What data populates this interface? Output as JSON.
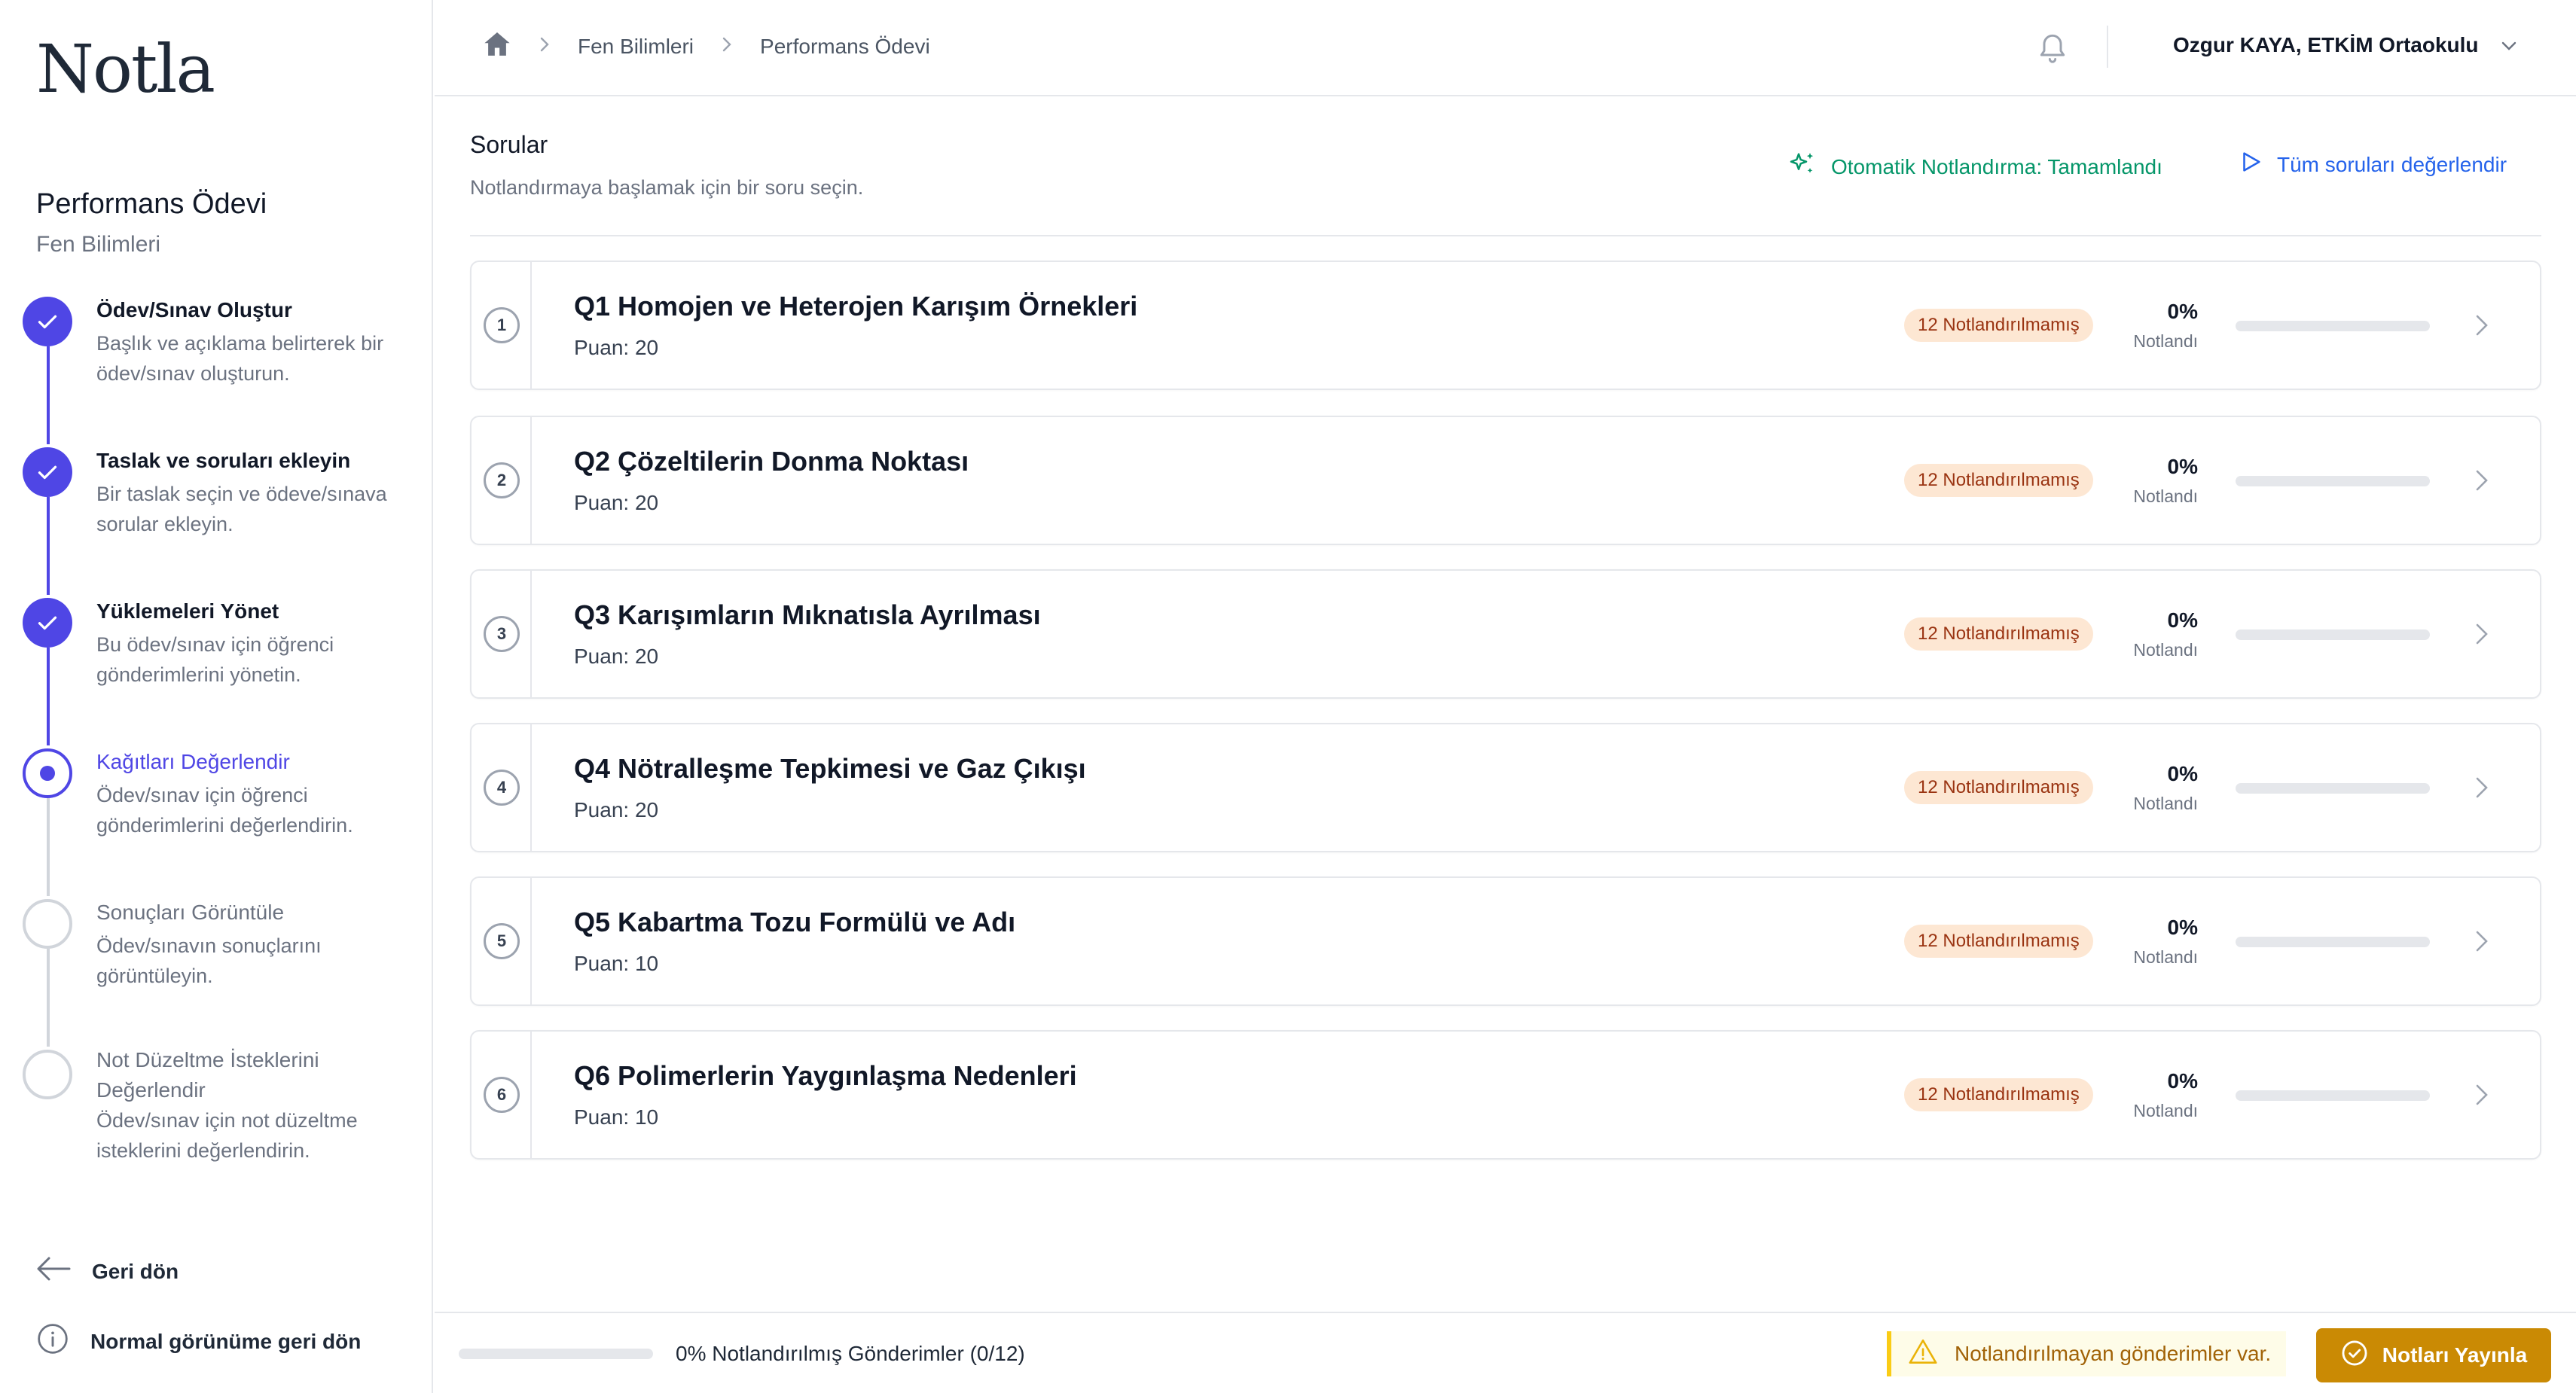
{
  "app": {
    "logo": "Notla"
  },
  "assignment": {
    "title": "Performans Ödevi",
    "subject": "Fen Bilimleri"
  },
  "steps": [
    {
      "title": "Ödev/Sınav Oluştur",
      "desc": "Başlık ve açıklama belirterek bir ödev/sınav oluşturun.",
      "state": "done"
    },
    {
      "title": "Taslak ve soruları ekleyin",
      "desc": "Bir taslak seçin ve ödeve/sınava sorular ekleyin.",
      "state": "done"
    },
    {
      "title": "Yüklemeleri Yönet",
      "desc": "Bu ödev/sınav için öğrenci gönderimlerini yönetin.",
      "state": "done"
    },
    {
      "title": "Kağıtları Değerlendir",
      "desc": "Ödev/sınav için öğrenci gönderimlerini değerlendirin.",
      "state": "current"
    },
    {
      "title": "Sonuçları Görüntüle",
      "desc": "Ödev/sınavın sonuçlarını görüntüleyin.",
      "state": "todo"
    },
    {
      "title": "Not Düzeltme İsteklerini Değerlendir",
      "desc": "Ödev/sınav için not düzeltme isteklerini değerlendirin.",
      "state": "todo"
    }
  ],
  "sidebar_footer": {
    "back": "Geri dön",
    "normal_view": "Normal görünüme geri dön"
  },
  "breadcrumb": {
    "subject": "Fen Bilimleri",
    "page": "Performans Ödevi"
  },
  "user": {
    "name": "Ozgur KAYA, ETKİM Ortaokulu"
  },
  "section": {
    "title": "Sorular",
    "subtitle": "Notlandırmaya başlamak için bir soru seçin.",
    "auto_grading": "Otomatik Notlandırma: Tamamlandı",
    "grade_all": "Tüm soruları değerlendir"
  },
  "questions": [
    {
      "num": "1",
      "title": "Q1 Homojen ve Heterojen Karışım Örnekleri",
      "points": "Puan: 20",
      "badge": "12 Notlandırılmamış",
      "percent": "0%",
      "percent_label": "Notlandı",
      "progress": 0
    },
    {
      "num": "2",
      "title": "Q2 Çözeltilerin Donma Noktası",
      "points": "Puan: 20",
      "badge": "12 Notlandırılmamış",
      "percent": "0%",
      "percent_label": "Notlandı",
      "progress": 0
    },
    {
      "num": "3",
      "title": "Q3 Karışımların Mıknatısla Ayrılması",
      "points": "Puan: 20",
      "badge": "12 Notlandırılmamış",
      "percent": "0%",
      "percent_label": "Notlandı",
      "progress": 0
    },
    {
      "num": "4",
      "title": "Q4 Nötralleşme Tepkimesi ve Gaz Çıkışı",
      "points": "Puan: 20",
      "badge": "12 Notlandırılmamış",
      "percent": "0%",
      "percent_label": "Notlandı",
      "progress": 0
    },
    {
      "num": "5",
      "title": "Q5 Kabartma Tozu Formülü ve Adı",
      "points": "Puan: 10",
      "badge": "12 Notlandırılmamış",
      "percent": "0%",
      "percent_label": "Notlandı",
      "progress": 0
    },
    {
      "num": "6",
      "title": "Q6 Polimerlerin Yaygınlaşma Nedenleri",
      "points": "Puan: 10",
      "badge": "12 Notlandırılmamış",
      "percent": "0%",
      "percent_label": "Notlandı",
      "progress": 0
    }
  ],
  "footer": {
    "summary": "0% Notlandırılmış Gönderimler (0/12)",
    "progress": 0,
    "warning": "Notlandırılmayan gönderimler var.",
    "publish": "Notları Yayınla"
  },
  "colors": {
    "accent": "#4f46e5",
    "success": "#059669",
    "link": "#2563eb",
    "publish": "#ca8a04",
    "badge_bg": "#fde7d3"
  }
}
